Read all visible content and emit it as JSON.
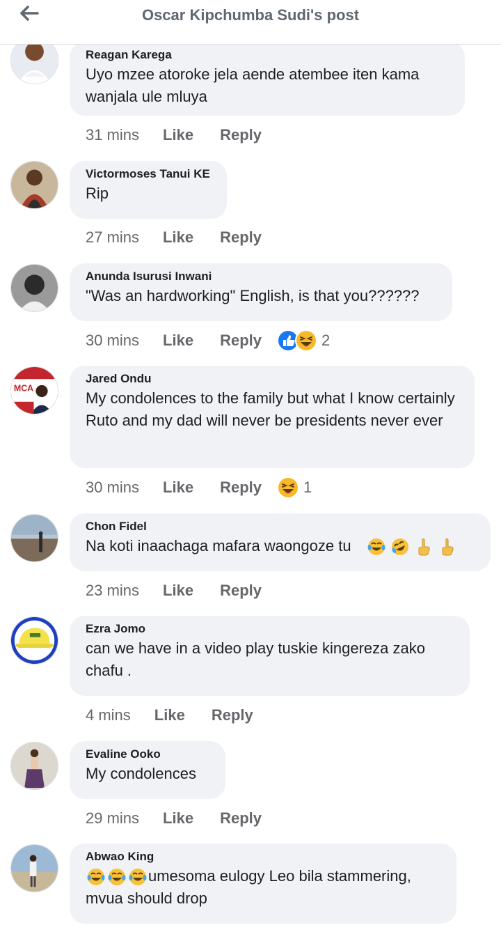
{
  "header": {
    "title": "Oscar Kipchumba Sudi's post",
    "back_icon": "arrow-left-icon"
  },
  "actions": {
    "like": "Like",
    "reply": "Reply"
  },
  "comments": [
    {
      "author": "Reagan Karega",
      "text": "Uyo mzee atoroke jela aende atembee iten kama wanjala ule mluya",
      "time": "31 mins"
    },
    {
      "author": "Victormoses Tanui KE",
      "text": "Rip",
      "time": "27 mins"
    },
    {
      "author": "Anunda Isurusi Inwani",
      "text": "\"Was an hardworking\" English, is that you??????",
      "time": "30 mins",
      "reactions": [
        "like",
        "haha"
      ],
      "reaction_count": "2"
    },
    {
      "author": "Jared Ondu",
      "text": "My condolences to the family but what I know certainly Ruto and my dad will never be presidents never ever",
      "time": "30 mins",
      "reactions": [
        "haha"
      ],
      "reaction_count": "1"
    },
    {
      "author": "Chon Fidel",
      "text": "Na koti inaachaga mafara waongoze tu",
      "emojis": [
        "tears-of-joy",
        "rolling-laughing",
        "pointing-up",
        "pointing-up"
      ],
      "time": "23 mins"
    },
    {
      "author": "Ezra Jomo",
      "text": "can we have in a video play tuskie kingereza zako chafu .",
      "time": "4 mins"
    },
    {
      "author": "Evaline Ooko",
      "text": "My condolences",
      "time": "29 mins"
    },
    {
      "author": "Abwao King",
      "emojis": [
        "tears-of-joy",
        "tears-of-joy",
        "tears-of-joy"
      ],
      "text": "umesoma eulogy Leo bila stammering, mvua should drop",
      "time": ""
    }
  ],
  "colors": {
    "bubble": "#f0f2f5",
    "meta": "#65676b",
    "like_blue": "#1877f2",
    "haha_yellow": "#f7b928"
  }
}
